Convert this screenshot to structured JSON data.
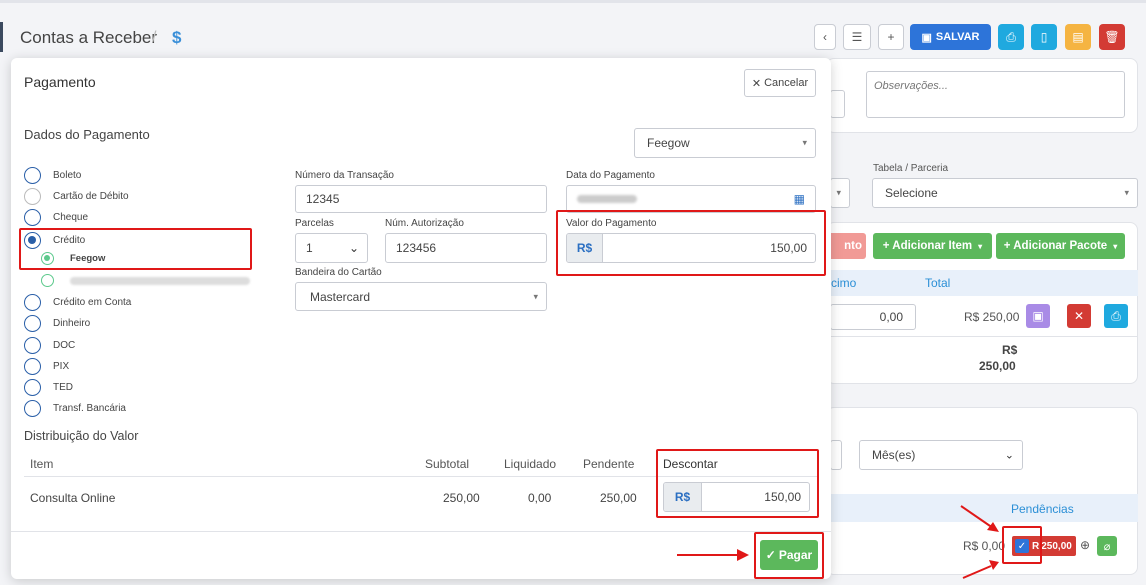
{
  "page": {
    "title": "Contas a Receber",
    "separator": "/",
    "icon": "dollar-icon"
  },
  "toolbar": {
    "back_icon": "chevron-left-icon",
    "list_icon": "list-icon",
    "add_icon": "plus-icon",
    "save_label": "SALVAR",
    "print_icon": "printer-icon",
    "doc_icon": "file-icon",
    "doc2_icon": "file-text-icon",
    "delete_icon": "trash-icon"
  },
  "background": {
    "observacoes_placeholder": "Observações...",
    "tabela_label": "Tabela / Parceria",
    "tabela_value": "Selecione",
    "partial_btn": "nto",
    "add_item_label": "+ Adicionar Item",
    "add_pacote_label": "+ Adicionar Pacote",
    "col_partial": "cimo",
    "col_total": "Total",
    "row_value": "0,00",
    "row_total": "R$ 250,00",
    "sum_currency": "R$",
    "sum_value": "250,00",
    "period_value": "Mês(es)",
    "pendencias_label": "Pendências",
    "pend_amount": "R$ 0,00",
    "pend_badge": "250,00",
    "pend_badge_prefix": "R"
  },
  "modal": {
    "title": "Pagamento",
    "cancel_label": "Cancelar",
    "section_dados": "Dados do Pagamento",
    "gateway_value": "Feegow",
    "payment_methods": [
      {
        "label": "Boleto",
        "state": "unchecked"
      },
      {
        "label": "Cartão de Débito",
        "state": "disabled"
      },
      {
        "label": "Cheque",
        "state": "unchecked"
      },
      {
        "label": "Crédito",
        "state": "checked"
      },
      {
        "label": "Crédito em Conta",
        "state": "unchecked"
      },
      {
        "label": "Dinheiro",
        "state": "unchecked"
      },
      {
        "label": "DOC",
        "state": "unchecked"
      },
      {
        "label": "PIX",
        "state": "unchecked"
      },
      {
        "label": "TED",
        "state": "unchecked"
      },
      {
        "label": "Transf. Bancária",
        "state": "unchecked"
      }
    ],
    "credit_sub": {
      "label": "Feegow"
    },
    "fields": {
      "transacao_label": "Número da Transação",
      "transacao_value": "12345",
      "data_label": "Data do Pagamento",
      "parcelas_label": "Parcelas",
      "parcelas_value": "1",
      "autorizacao_label": "Núm. Autorização",
      "autorizacao_value": "123456",
      "valor_label": "Valor do Pagamento",
      "valor_currency": "R$",
      "valor_value": "150,00",
      "bandeira_label": "Bandeira do Cartão",
      "bandeira_value": "Mastercard"
    },
    "distribuicao": {
      "title": "Distribuição do Valor",
      "headers": {
        "item": "Item",
        "subtotal": "Subtotal",
        "liquidado": "Liquidado",
        "pendente": "Pendente",
        "descontar": "Descontar"
      },
      "rows": [
        {
          "item": "Consulta Online",
          "subtotal": "250,00",
          "liquidado": "0,00",
          "pendente": "250,00",
          "currency": "R$",
          "descontar": "150,00"
        }
      ]
    },
    "pay_label": "Pagar"
  },
  "colors": {
    "primary": "#2d74d9",
    "success": "#5cb85c",
    "danger": "#d33b34",
    "highlight": "#e01818"
  }
}
